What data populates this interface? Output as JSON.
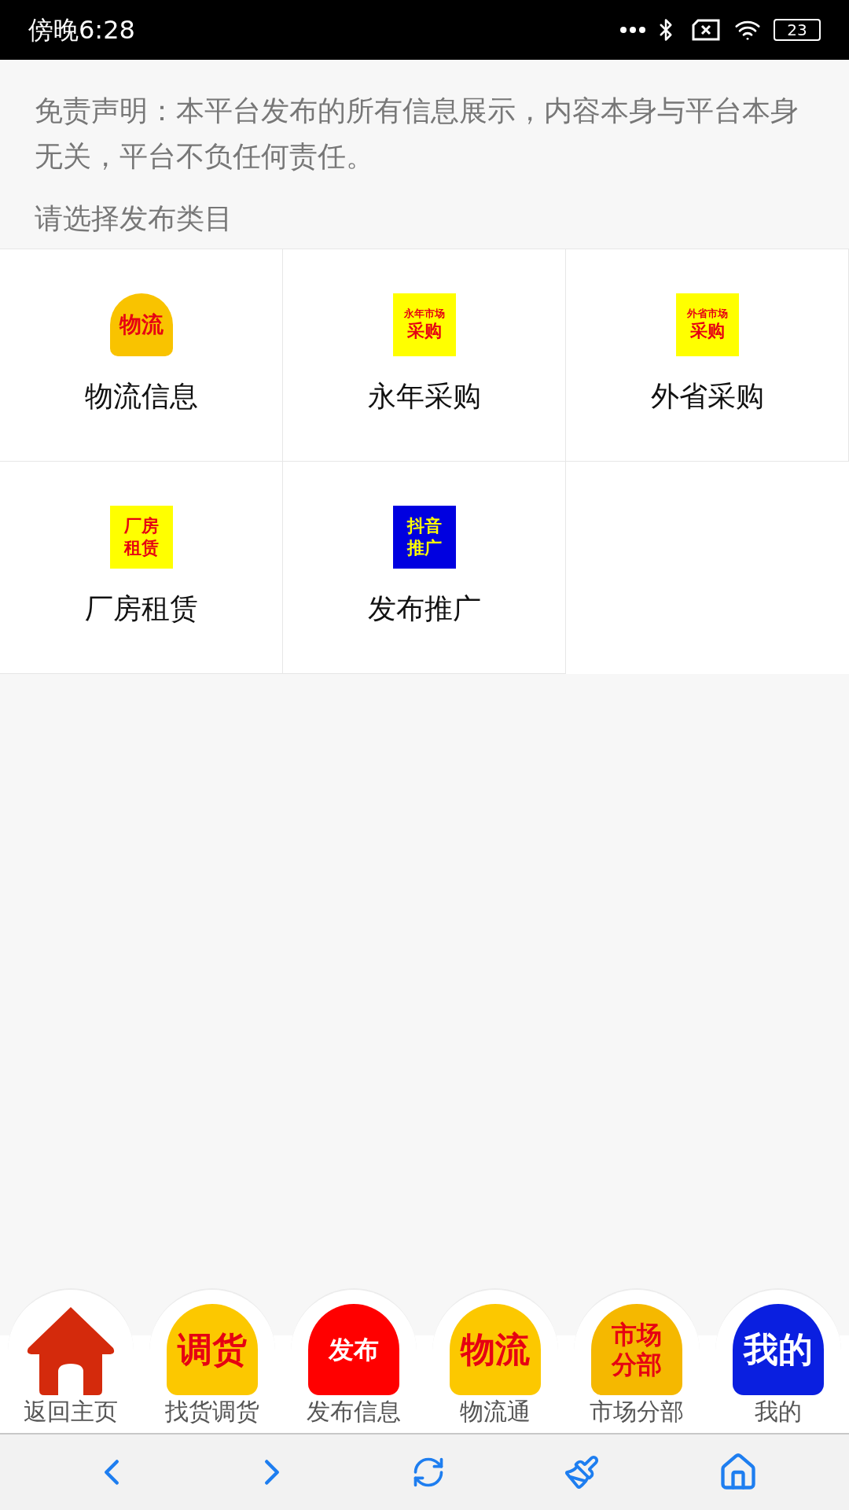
{
  "status_bar": {
    "time": "傍晚6:28",
    "battery": "23"
  },
  "disclaimer": "免责声明：本平台发布的所有信息展示，内容本身与平台本身无关，平台不负任何责任。",
  "section_title": "请选择发布类目",
  "categories": [
    {
      "label": "物流信息",
      "kind": "round",
      "badge": {
        "color": "#f9c300",
        "lines": [
          {
            "text": "物流",
            "color": "#e60012"
          }
        ]
      }
    },
    {
      "label": "永年采购",
      "kind": "square",
      "badge": {
        "color": "#ffff00",
        "lines": [
          {
            "text": "永年市场",
            "color": "#e60012"
          },
          {
            "text": "采购",
            "color": "#e60012"
          }
        ]
      }
    },
    {
      "label": "外省采购",
      "kind": "square",
      "badge": {
        "color": "#ffff00",
        "lines": [
          {
            "text": "外省市场",
            "color": "#e60012"
          },
          {
            "text": "采购",
            "color": "#e60012"
          }
        ]
      }
    },
    {
      "label": "厂房租赁",
      "kind": "square",
      "badge": {
        "color": "#ffff00",
        "lines": [
          {
            "text": "厂房",
            "color": "#e60012"
          },
          {
            "text": "租赁",
            "color": "#e60012"
          }
        ]
      }
    },
    {
      "label": "发布推广",
      "kind": "square",
      "badge": {
        "color": "#0000e0",
        "lines": [
          {
            "text": "抖音",
            "color": "#ffff00"
          },
          {
            "text": "推广",
            "color": "#ffff00"
          }
        ]
      }
    }
  ],
  "bottom_nav": [
    {
      "label": "返回主页",
      "kind": "house",
      "color": "#d42a0c"
    },
    {
      "label": "找货调货",
      "kind": "badge",
      "badge": {
        "color": "#fcc800",
        "lines": [
          {
            "text": "调货",
            "color": "#e60012"
          }
        ]
      }
    },
    {
      "label": "发布信息",
      "kind": "badge",
      "badge": {
        "color": "#ff0000",
        "lines": [
          {
            "text": "发布",
            "color": "#ffffff"
          }
        ]
      }
    },
    {
      "label": "物流通",
      "kind": "badge",
      "badge": {
        "color": "#fcc800",
        "lines": [
          {
            "text": "物流",
            "color": "#e60012"
          }
        ]
      }
    },
    {
      "label": "市场分部",
      "kind": "badge",
      "badge": {
        "color": "#f5b800",
        "lines": [
          {
            "text": "市场",
            "color": "#e60012"
          },
          {
            "text": "分部",
            "color": "#e60012"
          }
        ]
      }
    },
    {
      "label": "我的",
      "kind": "badge",
      "badge": {
        "color": "#0a1fe0",
        "lines": [
          {
            "text": "我的",
            "color": "#ffffff"
          }
        ]
      }
    }
  ]
}
